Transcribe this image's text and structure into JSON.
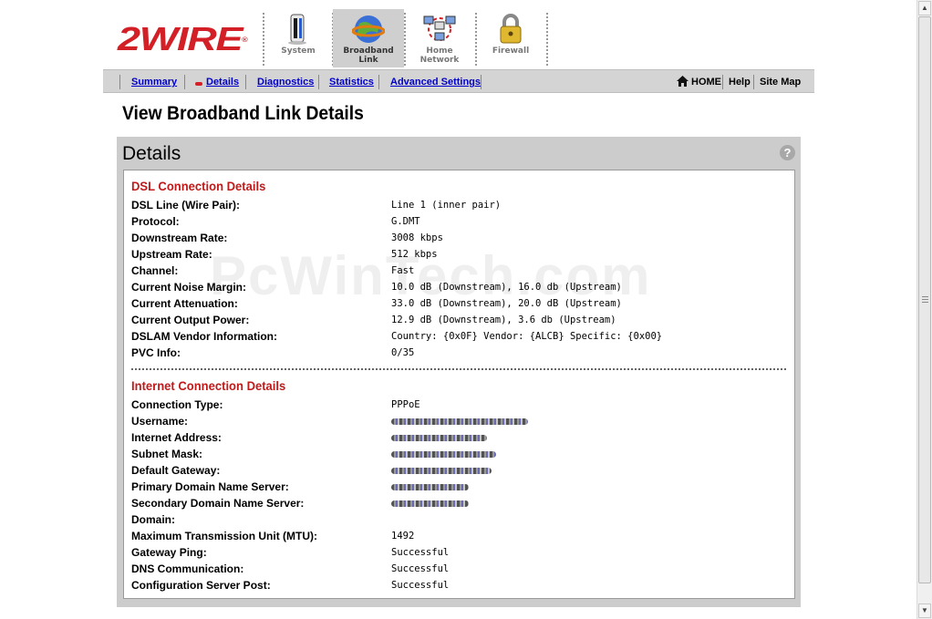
{
  "brand": {
    "logo_text": "2WIRE",
    "reg_mark": "®"
  },
  "tabs": [
    {
      "label_line1": "System",
      "label_line2": "",
      "icon": "system-icon"
    },
    {
      "label_line1": "Broadband",
      "label_line2": "Link",
      "icon": "globe-icon"
    },
    {
      "label_line1": "Home",
      "label_line2": "Network",
      "icon": "network-icon"
    },
    {
      "label_line1": "Firewall",
      "label_line2": "",
      "icon": "padlock-icon"
    }
  ],
  "nav": {
    "links": [
      "Summary",
      "Details",
      "Diagnostics",
      "Statistics",
      "Advanced Settings"
    ],
    "home": "HOME",
    "help": "Help",
    "sitemap": "Site Map"
  },
  "page_title": "View Broadband Link Details",
  "panel": {
    "title": "Details",
    "help_symbol": "?"
  },
  "dsl": {
    "heading": "DSL Connection Details",
    "rows": [
      {
        "label": "DSL Line (Wire Pair):",
        "value": "Line 1 (inner pair)"
      },
      {
        "label": "Protocol:",
        "value": "G.DMT"
      },
      {
        "label": "Downstream Rate:",
        "value": "3008 kbps"
      },
      {
        "label": "Upstream Rate:",
        "value": "512 kbps"
      },
      {
        "label": "Channel:",
        "value": "Fast"
      },
      {
        "label": "Current Noise Margin:",
        "value": "10.0 dB (Downstream), 16.0 db (Upstream)"
      },
      {
        "label": "Current Attenuation:",
        "value": "33.0 dB (Downstream), 20.0 dB (Upstream)"
      },
      {
        "label": "Current Output Power:",
        "value": "12.9 dB (Downstream), 3.6 db (Upstream)"
      },
      {
        "label": "DSLAM Vendor Information:",
        "value": "Country: {0x0F} Vendor: {ALCB} Specific: {0x00}"
      },
      {
        "label": "PVC Info:",
        "value": "0/35"
      }
    ]
  },
  "internet": {
    "heading": "Internet Connection Details",
    "rows": [
      {
        "label": "Connection Type:",
        "value": "PPPoE"
      },
      {
        "label": "Username:",
        "value": ""
      },
      {
        "label": "Internet Address:",
        "value": ""
      },
      {
        "label": "Subnet Mask:",
        "value": ""
      },
      {
        "label": "Default Gateway:",
        "value": ""
      },
      {
        "label": "Primary Domain Name Server:",
        "value": ""
      },
      {
        "label": "Secondary Domain Name Server:",
        "value": ""
      },
      {
        "label": "Domain:",
        "value": ""
      },
      {
        "label": "Maximum Transmission Unit (MTU):",
        "value": "1492"
      },
      {
        "label": "Gateway Ping:",
        "value": "Successful"
      },
      {
        "label": "DNS Communication:",
        "value": "Successful"
      },
      {
        "label": "Configuration Server Post:",
        "value": "Successful"
      }
    ]
  },
  "watermark": "PcWinTech.com",
  "colors": {
    "brand_red": "#d31f26",
    "section_red": "#c01a1a",
    "link_blue": "#0000cc",
    "panel_gray": "#cccccc"
  }
}
